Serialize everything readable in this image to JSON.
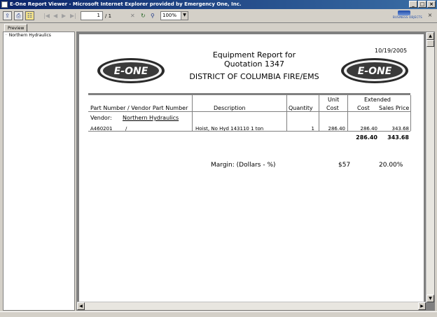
{
  "window": {
    "title": "E-One Report Viewer - Microsoft Internet Explorer provided by Emergency One, Inc.",
    "minimize": "_",
    "maximize": "□",
    "close": "×"
  },
  "toolbar": {
    "page_current": "1",
    "page_total": "/ 1",
    "zoom": "100%",
    "brand": "BUSINESS OBJECTS",
    "close_x": "×"
  },
  "tabs": [
    {
      "label": "Preview"
    }
  ],
  "tree": {
    "items": [
      {
        "label": "Northern Hydraulics"
      }
    ]
  },
  "report": {
    "date": "10/19/2005",
    "title_line1": "Equipment Report for",
    "title_line2": "Quotation 1347",
    "title_line3": "DISTRICT OF COLUMBIA FIRE/EMS",
    "logo_text": "E-ONE",
    "columns": {
      "part": "Part Number / Vendor Part Number",
      "description": "Description",
      "quantity": "Quantity",
      "unit_cost_1": "Unit",
      "unit_cost_2": "Cost",
      "extended": "Extended",
      "ext_cost": "Cost",
      "ext_price": "Sales Price"
    },
    "vendor_label": "Vendor:",
    "vendor_name": "Northern Hydraulics",
    "rows": [
      {
        "part": "A460201",
        "vendor_part": "/",
        "description": "Hoist, No Hyd 143110 1 ton",
        "quantity": "1",
        "unit_cost": "286.40",
        "ext_cost": "286.40",
        "sales_price": "343.68"
      }
    ],
    "totals": {
      "ext_cost": "286.40",
      "sales_price": "343.68"
    },
    "margin_label": "Margin: (Dollars - %)",
    "margin_dollars": "$57",
    "margin_percent": "20.00%"
  },
  "colors": {
    "titlebar_start": "#0a246a",
    "titlebar_end": "#3a6ea5",
    "chrome": "#d4d0c8"
  }
}
